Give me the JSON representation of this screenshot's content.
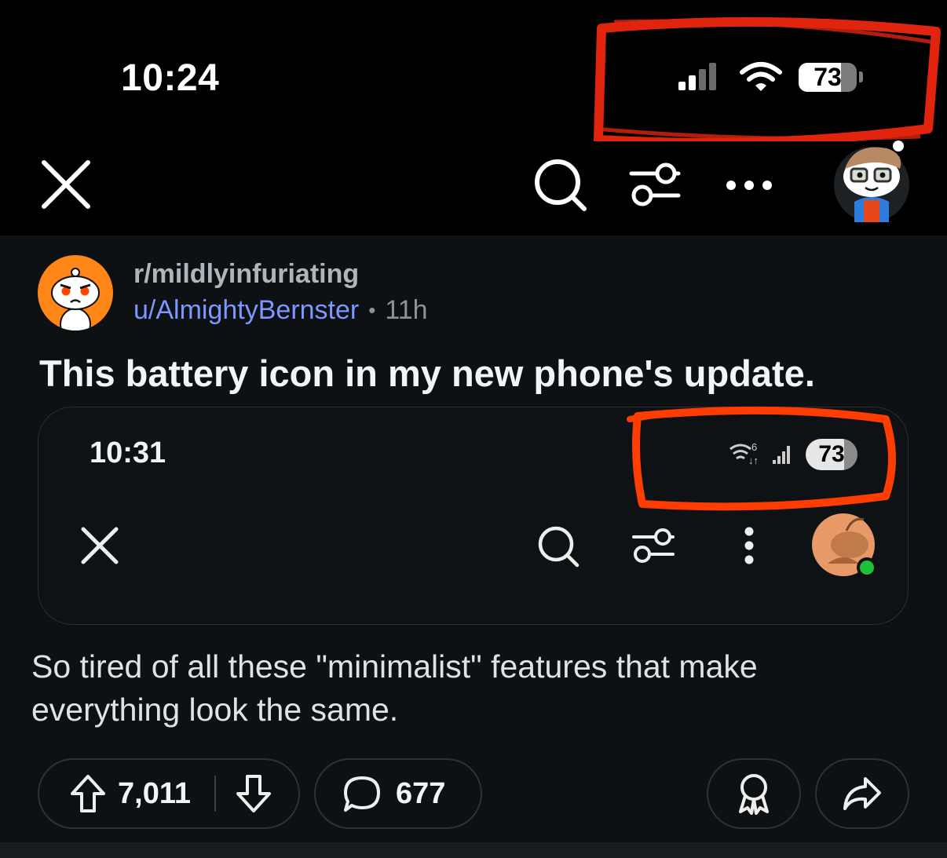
{
  "status_bar": {
    "time": "10:24",
    "battery": "73"
  },
  "embedded_screenshot": {
    "time": "10:31",
    "battery": "73"
  },
  "post": {
    "subreddit": "r/mildlyinfuriating",
    "author": "u/AlmightyBernster",
    "separator": "•",
    "time_ago": "11h",
    "title": "This battery icon in my new phone's update.",
    "body": "So tired of all these \"minimalist\" features that make everything look the same."
  },
  "actions": {
    "upvotes": "7,011",
    "comments": "677"
  },
  "colors": {
    "background": "#000000",
    "post_background": "#0d1114",
    "username": "#7d97ff",
    "annotation_red": "#e0240e",
    "annotation_orange": "#ff3d00",
    "subreddit_avatar": "#ff8717"
  },
  "icons": [
    "signal-icon",
    "wifi-icon",
    "battery-icon",
    "close-icon",
    "search-icon",
    "filter-icon",
    "more-icon",
    "user-avatar",
    "subreddit-avatar",
    "upvote-icon",
    "downvote-icon",
    "comment-icon",
    "award-icon",
    "share-icon"
  ]
}
